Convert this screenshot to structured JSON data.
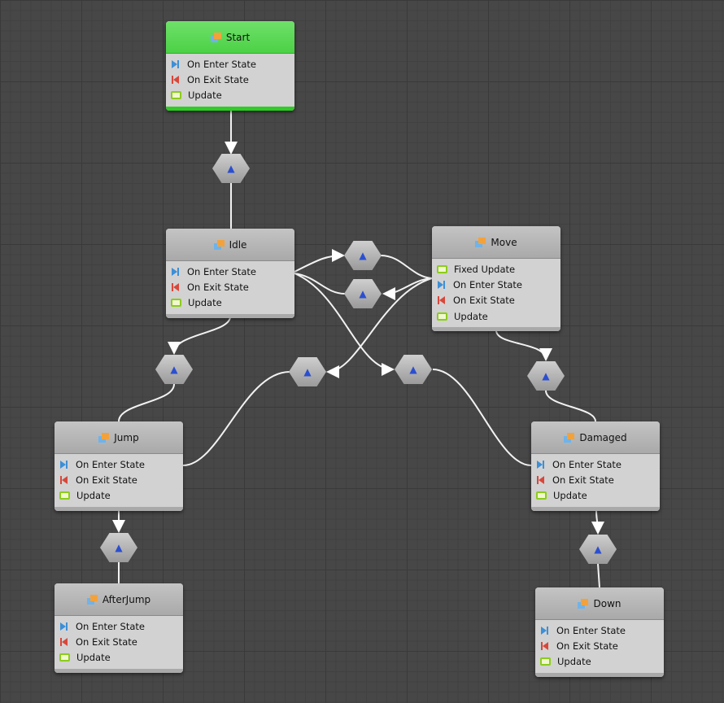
{
  "nodes": [
    {
      "title": "Start",
      "rows": [
        {
          "icon": "enter",
          "label": "On Enter State"
        },
        {
          "icon": "exit",
          "label": "On Exit State"
        },
        {
          "icon": "update",
          "label": "Update"
        }
      ]
    },
    {
      "title": "Idle",
      "rows": [
        {
          "icon": "enter",
          "label": "On Enter State"
        },
        {
          "icon": "exit",
          "label": "On Exit State"
        },
        {
          "icon": "update",
          "label": "Update"
        }
      ]
    },
    {
      "title": "Move",
      "rows": [
        {
          "icon": "update",
          "label": "Fixed Update"
        },
        {
          "icon": "enter",
          "label": "On Enter State"
        },
        {
          "icon": "exit",
          "label": "On Exit State"
        },
        {
          "icon": "update",
          "label": "Update"
        }
      ]
    },
    {
      "title": "Jump",
      "rows": [
        {
          "icon": "enter",
          "label": "On Enter State"
        },
        {
          "icon": "exit",
          "label": "On Exit State"
        },
        {
          "icon": "update",
          "label": "Update"
        }
      ]
    },
    {
      "title": "Damaged",
      "rows": [
        {
          "icon": "enter",
          "label": "On Enter State"
        },
        {
          "icon": "exit",
          "label": "On Exit State"
        },
        {
          "icon": "update",
          "label": "Update"
        }
      ]
    },
    {
      "title": "AfterJump",
      "rows": [
        {
          "icon": "enter",
          "label": "On Enter State"
        },
        {
          "icon": "exit",
          "label": "On Exit State"
        },
        {
          "icon": "update",
          "label": "Update"
        }
      ]
    },
    {
      "title": "Down",
      "rows": [
        {
          "icon": "enter",
          "label": "On Enter State"
        },
        {
          "icon": "exit",
          "label": "On Exit State"
        },
        {
          "icon": "update",
          "label": "Update"
        }
      ]
    }
  ],
  "colors": {
    "start_header": "#4cd146",
    "background": "#474747",
    "enter": "#3d8fd6",
    "exit": "#d8473a",
    "update": "#8ccc1c"
  },
  "transition_icon": "transition-icon"
}
